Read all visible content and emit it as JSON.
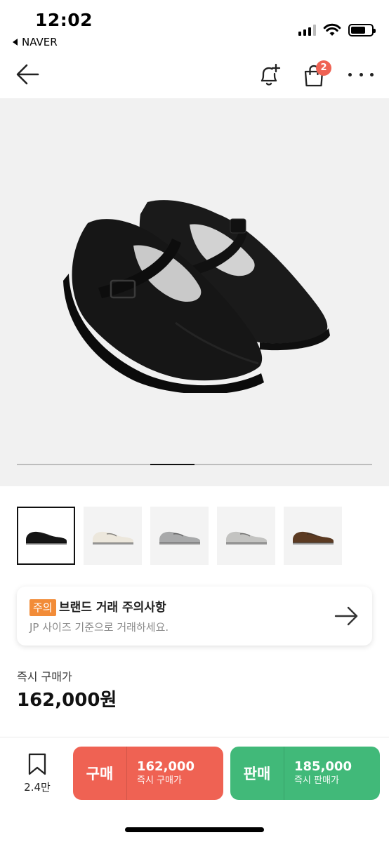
{
  "status_bar": {
    "time": "12:02",
    "back_app": "NAVER"
  },
  "nav": {
    "cart_badge": "2"
  },
  "hero": {
    "progress_fraction": 0.125,
    "active_slide": 4,
    "total_slides": 8
  },
  "thumbnails": [
    {
      "color": "#151515",
      "active": true
    },
    {
      "color": "#ece7dc",
      "active": false
    },
    {
      "color": "#a8a9aa",
      "active": false
    },
    {
      "color": "#c3c3c1",
      "active": false
    },
    {
      "color": "#5b3a22",
      "active": false
    }
  ],
  "notice": {
    "tag": "주의",
    "title": "브랜드 거래 주의사항",
    "description": "JP 사이즈 기준으로 거래하세요."
  },
  "price": {
    "label": "즉시 구매가",
    "value": "162,000원"
  },
  "bottom_bar": {
    "wish_count": "2.4만",
    "buy": {
      "label": "구매",
      "price": "162,000",
      "sub": "즉시 구매가"
    },
    "sell": {
      "label": "판매",
      "price": "185,000",
      "sub": "즉시 판매가"
    }
  },
  "colors": {
    "buy": "#ef6253",
    "sell": "#41b979",
    "notice_tag": "#f28c38",
    "badge": "#ef6253"
  }
}
